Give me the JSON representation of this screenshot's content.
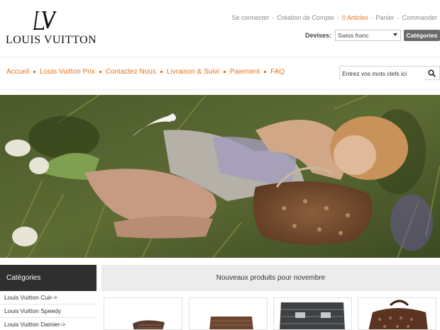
{
  "brand": {
    "name": "LOUIS VUITTON"
  },
  "header": {
    "links": [
      {
        "label": "Se connecter",
        "accent": false
      },
      {
        "label": "Création de Compte",
        "accent": false
      },
      {
        "label": "0 Articles",
        "accent": true
      },
      {
        "label": "Panier",
        "accent": false
      },
      {
        "label": "Commander",
        "accent": false
      }
    ],
    "currency_label": "Devises:",
    "currency_value": "Swiss franc",
    "categories_button": "Catégories"
  },
  "nav": {
    "items": [
      "Accueil",
      "Louis Vuitton Prix",
      "Contactez Nous",
      "Livraison & Suivi",
      "Paiement",
      "FAQ"
    ]
  },
  "search": {
    "placeholder": "Entrez vos mots clefs ici"
  },
  "sidebar": {
    "title": "Catégories",
    "items": [
      "Louis Vuitton Cuir->",
      "Louis Vuitton Speedy",
      "Louis Vuitton Damier->"
    ]
  },
  "main": {
    "title": "Nouveaux produits pour novembre"
  },
  "colors": {
    "accent": "#e8721c",
    "dark": "#2f2f2f",
    "button": "#6b6b6b"
  }
}
